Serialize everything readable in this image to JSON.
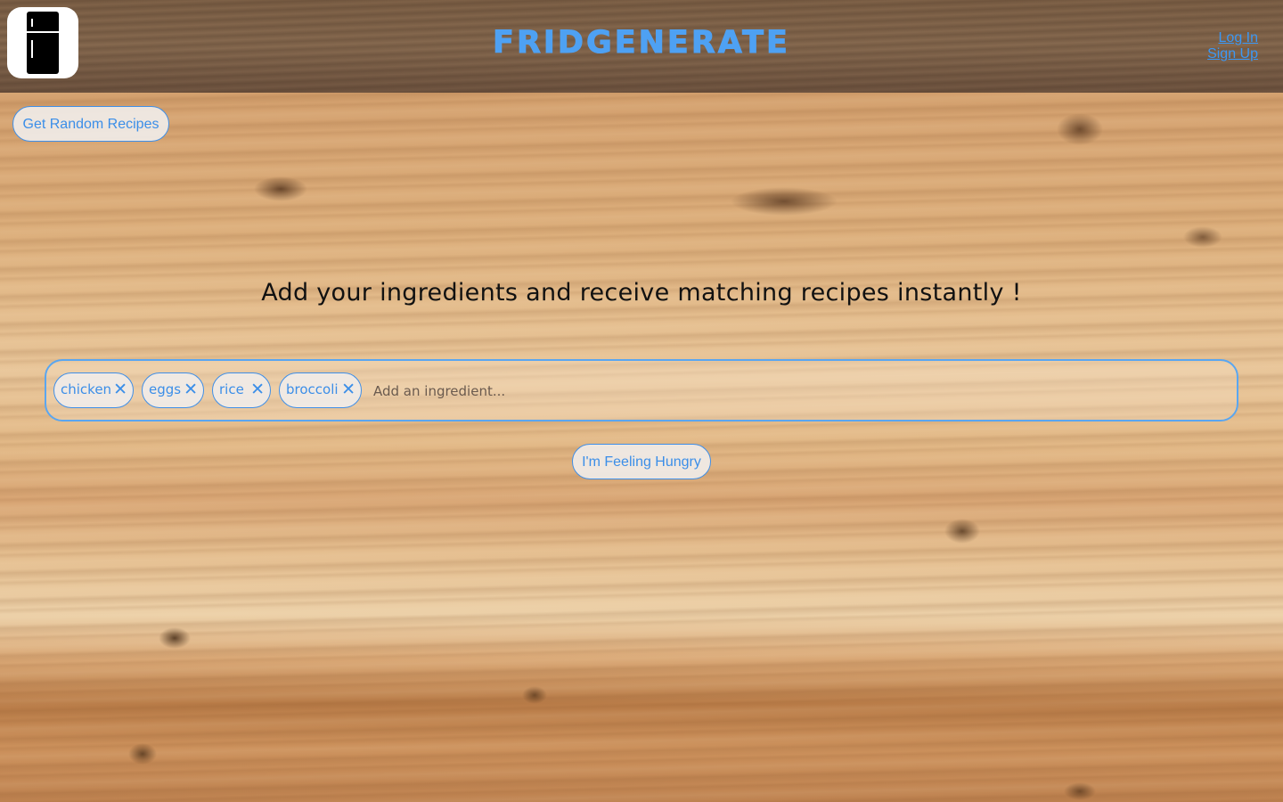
{
  "header": {
    "logo_icon": "fridge-icon",
    "brand_title": "FRIDGENERATE",
    "login_label": "Log In",
    "signup_label": "Sign Up",
    "brand_color": "#4ea1f3"
  },
  "actions": {
    "random_recipes_label": "Get Random Recipes",
    "feeling_hungry_label": "I'm Feeling Hungry"
  },
  "main": {
    "tagline": "Add your ingredients and receive matching recipes instantly !",
    "ingredients": [
      {
        "label": "chicken",
        "remove_icon": "close-icon"
      },
      {
        "label": "eggs",
        "remove_icon": "close-icon"
      },
      {
        "label": "rice",
        "remove_icon": "close-icon"
      },
      {
        "label": "broccoli",
        "remove_icon": "close-icon"
      }
    ],
    "input_placeholder": "Add an ingredient...",
    "input_value": ""
  },
  "colors": {
    "accent": "#3b8ee8"
  }
}
